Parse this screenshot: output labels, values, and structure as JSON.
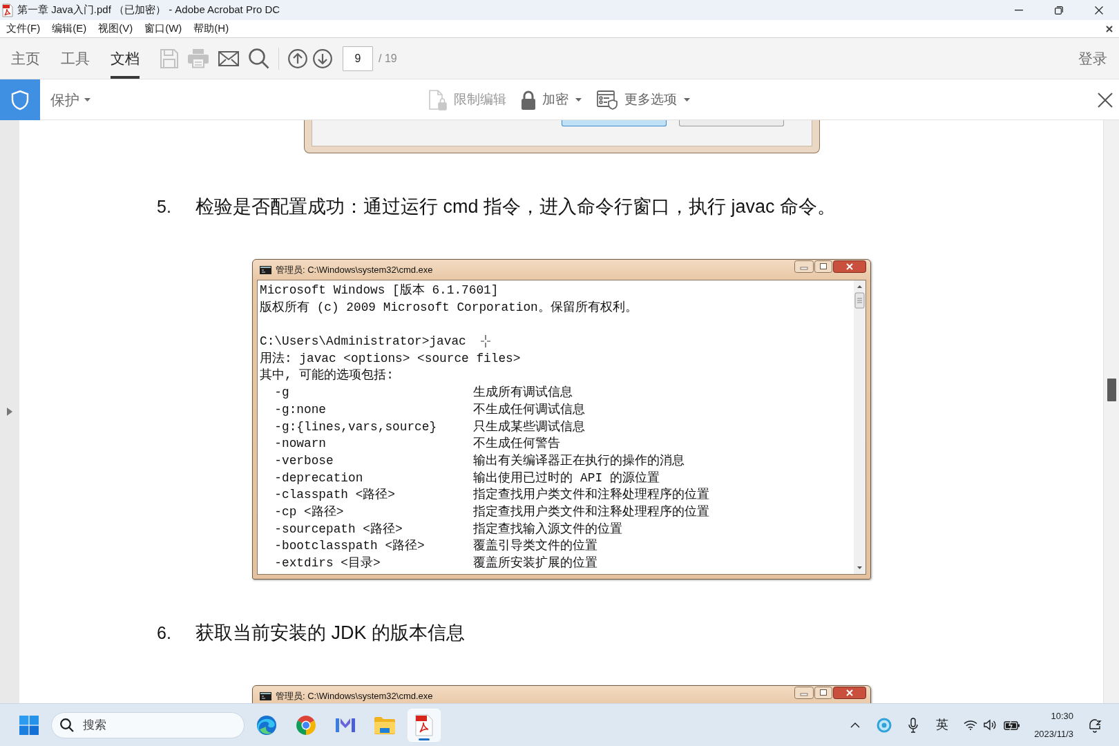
{
  "window": {
    "title": "第一章 Java入门.pdf （已加密） - Adobe Acrobat Pro DC"
  },
  "menu": [
    "文件(F)",
    "编辑(E)",
    "视图(V)",
    "窗口(W)",
    "帮助(H)"
  ],
  "toolbar": {
    "tabs": [
      {
        "label": "主页",
        "selected": false
      },
      {
        "label": "工具",
        "selected": false
      },
      {
        "label": "文档",
        "selected": true
      }
    ],
    "action_groups": [
      [
        {
          "kind": "save",
          "disabled": true
        },
        {
          "kind": "print",
          "disabled": true
        },
        {
          "kind": "email",
          "disabled": false
        },
        {
          "kind": "search",
          "disabled": false
        }
      ],
      [
        {
          "kind": "previous_page",
          "disabled": false
        },
        {
          "kind": "next_page",
          "disabled": false
        }
      ]
    ],
    "page_field": {
      "value": "9"
    },
    "page_total": "/ 19",
    "sign_in": "登录"
  },
  "protect_bar": {
    "title": "保护",
    "tools": [
      {
        "kind": "restrict_editing",
        "label": "限制编辑",
        "disabled": true,
        "dropdown": false
      },
      {
        "kind": "encrypt",
        "label": "加密",
        "disabled": false,
        "dropdown": true
      },
      {
        "kind": "more_options",
        "label": "更多选项",
        "disabled": false,
        "dropdown": true
      }
    ]
  },
  "document": {
    "blocks": [
      {
        "kind": "dialog_image"
      },
      {
        "kind": "step",
        "number": "5.",
        "text": "检验是否配置成功：通过运行 cmd 指令，进入命令行窗口，执行 javac 命令。"
      },
      {
        "kind": "console",
        "title": "管理员: C:\\Windows\\system32\\cmd.exe",
        "lines": [
          {
            "kind": "text",
            "text": "Microsoft Windows [版本 6.1.7601]"
          },
          {
            "kind": "text",
            "text": "版权所有 (c) 2009 Microsoft Corporation。保留所有权利。"
          },
          {
            "kind": "blank"
          },
          {
            "kind": "prompt",
            "text": "C:\\Users\\Administrator>javac"
          },
          {
            "kind": "text",
            "text": "用法: javac <options> <source files>"
          },
          {
            "kind": "text",
            "text": "其中, 可能的选项包括:"
          },
          {
            "kind": "option",
            "option": "-g",
            "description": "生成所有调试信息"
          },
          {
            "kind": "option",
            "option": "-g:none",
            "description": "不生成任何调试信息"
          },
          {
            "kind": "option",
            "option": "-g:{lines,vars,source}",
            "description": "只生成某些调试信息"
          },
          {
            "kind": "option",
            "option": "-nowarn",
            "description": "不生成任何警告"
          },
          {
            "kind": "option",
            "option": "-verbose",
            "description": "输出有关编译器正在执行的操作的消息"
          },
          {
            "kind": "option",
            "option": "-deprecation",
            "description": "输出使用已过时的 API 的源位置"
          },
          {
            "kind": "option",
            "option": "-classpath <路径>",
            "description": "指定查找用户类文件和注释处理程序的位置"
          },
          {
            "kind": "option",
            "option": "-cp <路径>",
            "description": "指定查找用户类文件和注释处理程序的位置"
          },
          {
            "kind": "option",
            "option": "-sourcepath <路径>",
            "description": "指定查找输入源文件的位置"
          },
          {
            "kind": "option",
            "option": "-bootclasspath <路径>",
            "description": "覆盖引导类文件的位置"
          },
          {
            "kind": "option",
            "option": "-extdirs <目录>",
            "description": "覆盖所安装扩展的位置"
          }
        ]
      },
      {
        "kind": "step",
        "number": "6.",
        "text": "获取当前安装的 JDK 的版本信息"
      },
      {
        "kind": "console",
        "title": "管理员: C:\\Windows\\system32\\cmd.exe"
      }
    ]
  },
  "taskbar": {
    "search": {
      "placeholder": "搜索"
    },
    "apps": [
      {
        "kind": "edge",
        "selected": false
      },
      {
        "kind": "chrome",
        "selected": false
      },
      {
        "kind": "mail",
        "selected": false
      },
      {
        "kind": "explorer",
        "selected": false
      },
      {
        "kind": "acrobat",
        "selected": true
      }
    ],
    "input_method": "英",
    "clock": {
      "time": "10:30",
      "date": "2023/11/3"
    }
  }
}
